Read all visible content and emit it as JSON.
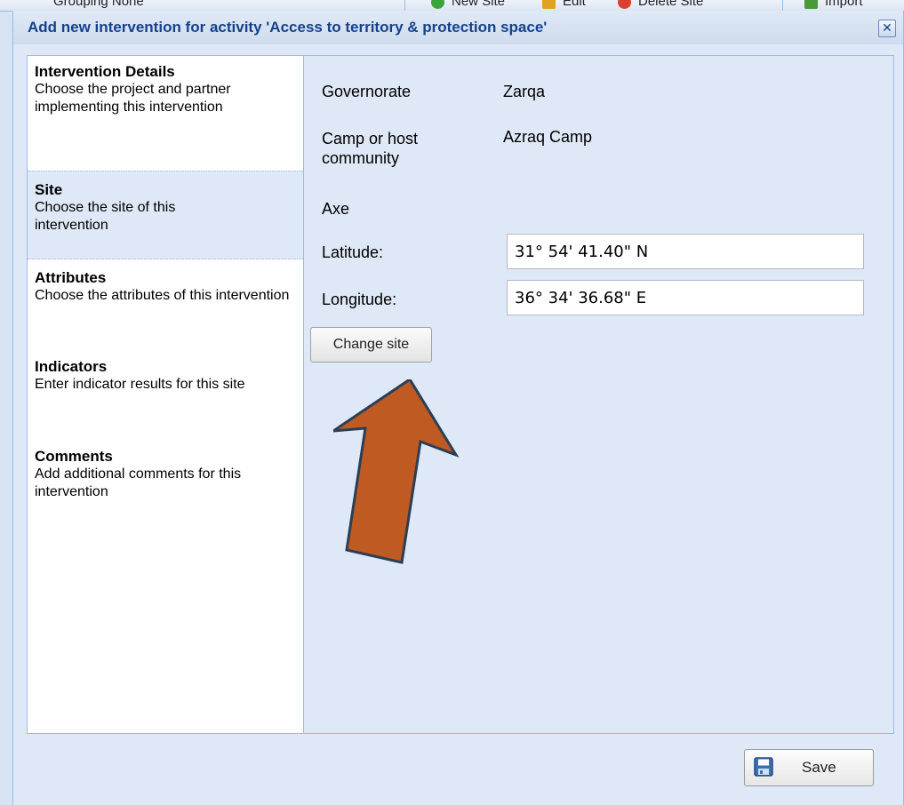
{
  "background_toolbar": {
    "items": [
      {
        "label": "Grouping None"
      },
      {
        "label": "New Site"
      },
      {
        "label": "Edit"
      },
      {
        "label": "Delete Site"
      },
      {
        "label": "Import"
      }
    ]
  },
  "window": {
    "title": "Add new intervention for activity 'Access to territory & protection space'",
    "close_icon": "close-icon"
  },
  "nav": {
    "items": [
      {
        "title": "Intervention Details",
        "desc": "Choose the project and partner implementing this intervention",
        "selected": false
      },
      {
        "title": "Site",
        "desc": "Choose the site of this intervention",
        "selected": true
      },
      {
        "title": "Attributes",
        "desc": "Choose the attributes of this intervention",
        "selected": false
      },
      {
        "title": "Indicators",
        "desc": "Enter indicator results for this site",
        "selected": false
      },
      {
        "title": "Comments",
        "desc": "Add additional comments for this intervention",
        "selected": false
      }
    ]
  },
  "site": {
    "governorate_label": "Governorate",
    "governorate_value": "Zarqa",
    "camp_label": "Camp or host community",
    "camp_value": "Azraq Camp",
    "axe_label": "Axe",
    "latitude_label": "Latitude:",
    "latitude_value": "31° 54' 41.40\" N",
    "longitude_label": "Longitude:",
    "longitude_value": "36° 34' 36.68\" E",
    "change_site_label": "Change site"
  },
  "annotation": {
    "arrow_color": "#bf5b22",
    "arrow_outline": "#2c3e55"
  },
  "footer": {
    "save_label": "Save"
  },
  "colors": {
    "title_text": "#15428b",
    "panel_bg": "#dfe8f6",
    "border": "#99bbe8"
  }
}
